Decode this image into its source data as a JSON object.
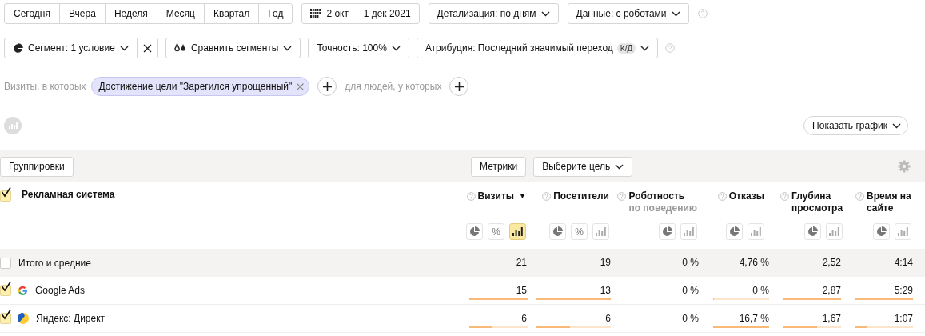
{
  "periods": [
    {
      "label": "Сегодня",
      "selected": false
    },
    {
      "label": "Вчера",
      "selected": false
    },
    {
      "label": "Неделя",
      "selected": false
    },
    {
      "label": "Месяц",
      "selected": false
    },
    {
      "label": "Квартал",
      "selected": false
    },
    {
      "label": "Год",
      "selected": false
    }
  ],
  "date_range": "2 окт — 1 дек 2021",
  "detail_select": "Детализация: по дням",
  "data_select": "Данные: с роботами",
  "segment_select": "Сегмент: 1 условие",
  "compare_select": "Сравнить сегменты",
  "accuracy_select": "Точность: 100%",
  "attribution_select": {
    "label": "Атрибуция: Последний значимый переход",
    "badge": "К/Д"
  },
  "condition": {
    "visits_label": "Визиты, в которых",
    "chip": "Достижение цели \"Зарегился упрощенный\"",
    "people_label": "для людей, у которых"
  },
  "chart_toggle": "Показать график",
  "table": {
    "groupings_button": "Группировки",
    "metrics_button": "Метрики",
    "goal_select": "Выберите цель",
    "dimension": {
      "label": "Рекламная система",
      "checked": true
    },
    "columns": [
      {
        "title": "Визиты",
        "sort": "▼",
        "buttons": [
          {
            "kind": "pie",
            "selected": false
          },
          {
            "kind": "percent",
            "label": "%",
            "selected": false
          },
          {
            "kind": "bars",
            "selected": true
          }
        ]
      },
      {
        "title": "Посетители",
        "buttons": [
          {
            "kind": "pie",
            "selected": false
          },
          {
            "kind": "percent",
            "label": "%",
            "selected": false
          },
          {
            "kind": "bars",
            "selected": false
          }
        ]
      },
      {
        "title": "Роботность",
        "subtitle": "по поведению",
        "buttons": [
          {
            "kind": "pie",
            "selected": false
          },
          {
            "kind": "bars",
            "selected": false
          }
        ]
      },
      {
        "title": "Отказы",
        "buttons": [
          {
            "kind": "pie",
            "selected": false
          },
          {
            "kind": "bars",
            "selected": false
          }
        ]
      },
      {
        "title": "Глубина просмотра",
        "buttons": [
          {
            "kind": "pie",
            "selected": false
          },
          {
            "kind": "bars",
            "selected": false
          }
        ]
      },
      {
        "title": "Время на сайте",
        "buttons": [
          {
            "kind": "pie",
            "selected": false
          },
          {
            "kind": "bars",
            "selected": false
          }
        ]
      }
    ],
    "rows": [
      {
        "kind": "total",
        "label": "Итого и средние",
        "checked": false,
        "cells": [
          {
            "value": "21"
          },
          {
            "value": "19"
          },
          {
            "value": "0 %"
          },
          {
            "value": "4,76 %"
          },
          {
            "value": "2,52"
          },
          {
            "value": "4:14"
          }
        ]
      },
      {
        "kind": "source",
        "label": "Google Ads",
        "checked": true,
        "cells": [
          {
            "value": "15",
            "level": 1
          },
          {
            "value": "13",
            "level": 1
          },
          {
            "value": "0 %"
          },
          {
            "value": "0 %",
            "level": 0
          },
          {
            "value": "2,87",
            "level": 1
          },
          {
            "value": "5:29",
            "level": 1
          }
        ]
      },
      {
        "kind": "source",
        "label": "Яндекс: Директ",
        "checked": true,
        "cells": [
          {
            "value": "6",
            "level": 0.4
          },
          {
            "value": "6",
            "level": 0.46
          },
          {
            "value": "0 %"
          },
          {
            "value": "16,7 %",
            "level": 1
          },
          {
            "value": "1,67",
            "level": 0.58
          },
          {
            "value": "1:07",
            "level": 0.2
          }
        ]
      }
    ]
  }
}
